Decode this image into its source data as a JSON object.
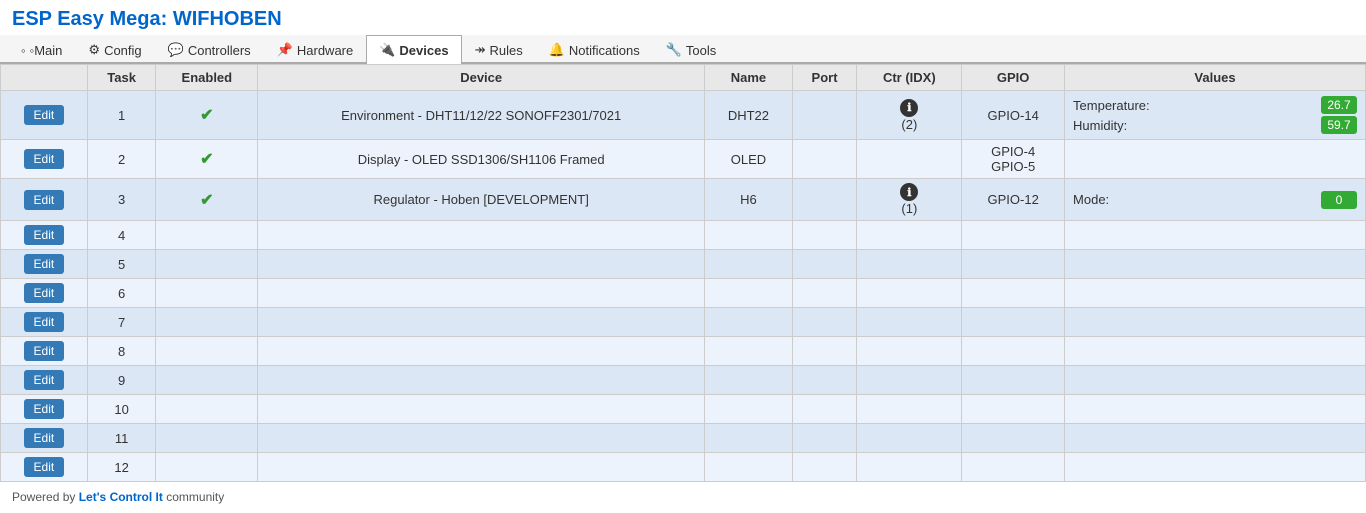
{
  "page": {
    "title": "ESP Easy Mega: WIFHOBEN"
  },
  "nav": {
    "items": [
      {
        "id": "main",
        "label": "◦Main",
        "icon": "",
        "active": false
      },
      {
        "id": "config",
        "label": "Config",
        "icon": "⚙",
        "active": false
      },
      {
        "id": "controllers",
        "label": "Controllers",
        "icon": "💬",
        "active": false
      },
      {
        "id": "hardware",
        "label": "Hardware",
        "icon": "📌",
        "active": false
      },
      {
        "id": "devices",
        "label": "Devices",
        "icon": "🔌",
        "active": true
      },
      {
        "id": "rules",
        "label": "Rules",
        "icon": "↠",
        "active": false
      },
      {
        "id": "notifications",
        "label": "Notifications",
        "icon": "🔔",
        "active": false
      },
      {
        "id": "tools",
        "label": "Tools",
        "icon": "🔧",
        "active": false
      }
    ]
  },
  "table": {
    "headers": [
      "",
      "Task",
      "Enabled",
      "Device",
      "Name",
      "Port",
      "Ctr (IDX)",
      "GPIO",
      "Values"
    ],
    "rows": [
      {
        "task": "1",
        "enabled": true,
        "device": "Environment - DHT11/12/22 SONOFF2301/7021",
        "name": "DHT22",
        "port": "",
        "ctr": "ℹ",
        "ctr_idx": "(2)",
        "gpio": "GPIO-14",
        "values": [
          {
            "label": "Temperature:",
            "value": "26.7"
          },
          {
            "label": "Humidity:",
            "value": "59.7"
          }
        ]
      },
      {
        "task": "2",
        "enabled": true,
        "device": "Display - OLED SSD1306/SH1106 Framed",
        "name": "OLED",
        "port": "",
        "ctr": "",
        "ctr_idx": "",
        "gpio": "GPIO-4\nGPIO-5",
        "values": []
      },
      {
        "task": "3",
        "enabled": true,
        "device": "Regulator - Hoben [DEVELOPMENT]",
        "name": "H6",
        "port": "",
        "ctr": "ℹ",
        "ctr_idx": "(1)",
        "gpio": "GPIO-12",
        "values": [
          {
            "label": "Mode:",
            "value": "0"
          }
        ]
      },
      {
        "task": "4",
        "enabled": false,
        "device": "",
        "name": "",
        "port": "",
        "ctr": "",
        "ctr_idx": "",
        "gpio": "",
        "values": []
      },
      {
        "task": "5",
        "enabled": false,
        "device": "",
        "name": "",
        "port": "",
        "ctr": "",
        "ctr_idx": "",
        "gpio": "",
        "values": []
      },
      {
        "task": "6",
        "enabled": false,
        "device": "",
        "name": "",
        "port": "",
        "ctr": "",
        "ctr_idx": "",
        "gpio": "",
        "values": []
      },
      {
        "task": "7",
        "enabled": false,
        "device": "",
        "name": "",
        "port": "",
        "ctr": "",
        "ctr_idx": "",
        "gpio": "",
        "values": []
      },
      {
        "task": "8",
        "enabled": false,
        "device": "",
        "name": "",
        "port": "",
        "ctr": "",
        "ctr_idx": "",
        "gpio": "",
        "values": []
      },
      {
        "task": "9",
        "enabled": false,
        "device": "",
        "name": "",
        "port": "",
        "ctr": "",
        "ctr_idx": "",
        "gpio": "",
        "values": []
      },
      {
        "task": "10",
        "enabled": false,
        "device": "",
        "name": "",
        "port": "",
        "ctr": "",
        "ctr_idx": "",
        "gpio": "",
        "values": []
      },
      {
        "task": "11",
        "enabled": false,
        "device": "",
        "name": "",
        "port": "",
        "ctr": "",
        "ctr_idx": "",
        "gpio": "",
        "values": []
      },
      {
        "task": "12",
        "enabled": false,
        "device": "",
        "name": "",
        "port": "",
        "ctr": "",
        "ctr_idx": "",
        "gpio": "",
        "values": []
      }
    ]
  },
  "footer": {
    "prefix": "Powered by ",
    "link_text": "Let's Control It",
    "suffix": " community"
  },
  "buttons": {
    "edit_label": "Edit"
  }
}
